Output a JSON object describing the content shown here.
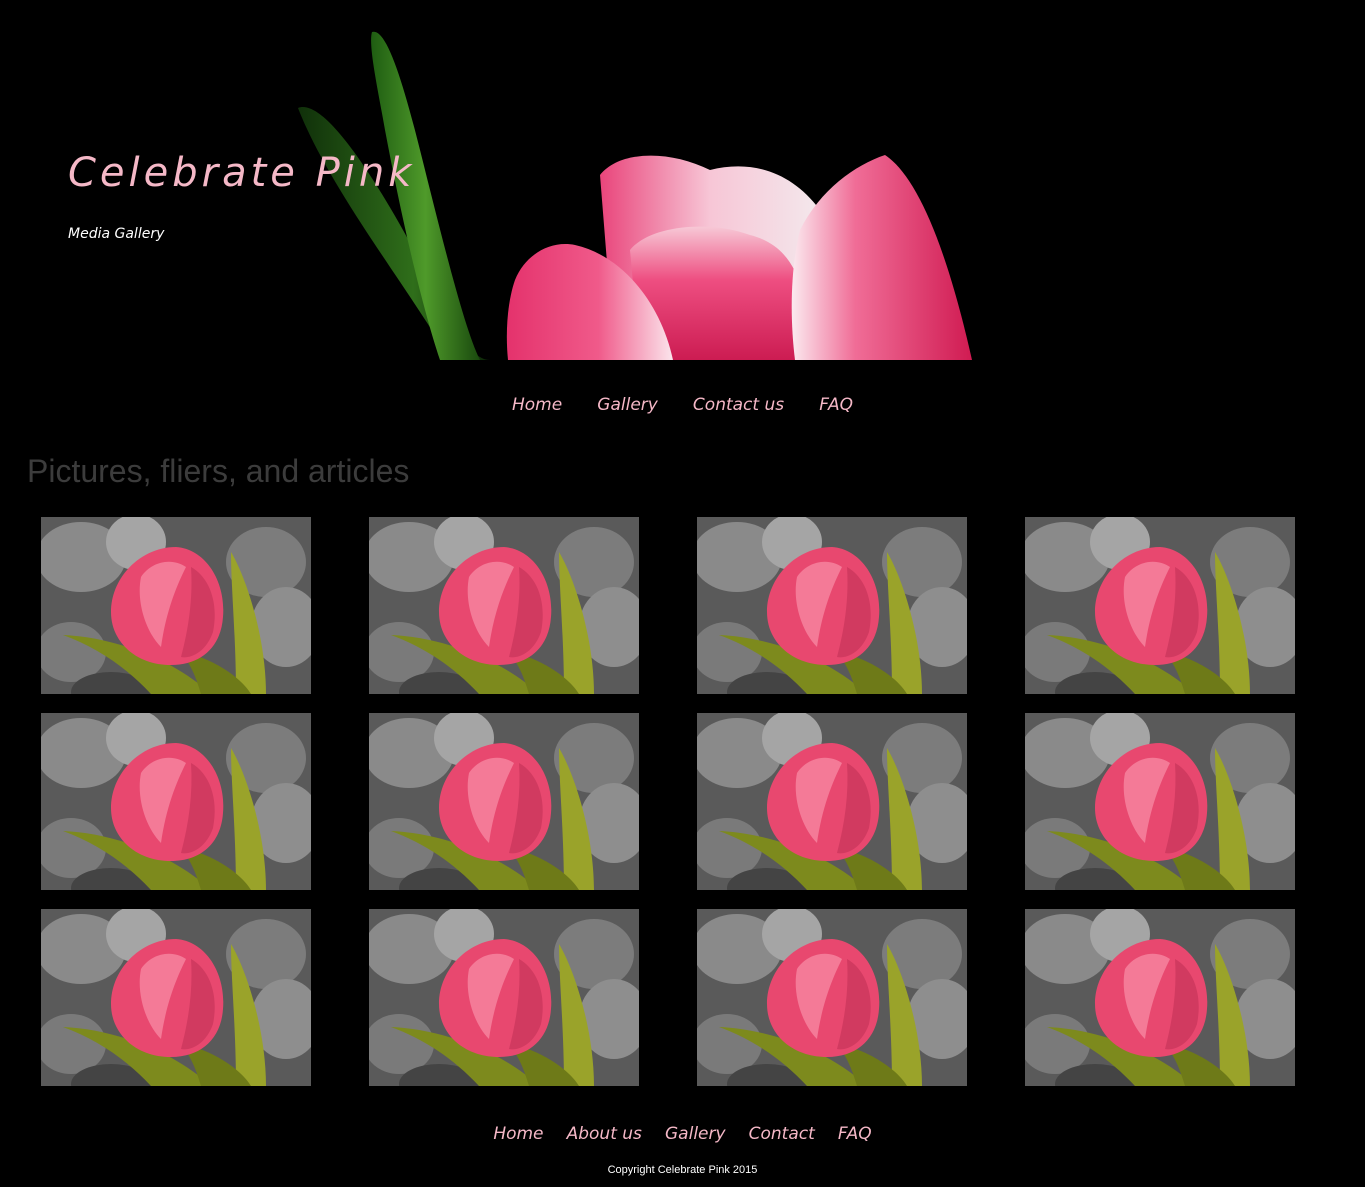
{
  "header": {
    "site_title": "Celebrate Pink",
    "site_subtitle": "Media Gallery"
  },
  "main_nav": {
    "items": [
      {
        "label": "Home"
      },
      {
        "label": "Gallery"
      },
      {
        "label": "Contact us"
      },
      {
        "label": "FAQ"
      }
    ]
  },
  "main": {
    "heading": "Pictures, fliers, and articles",
    "gallery": {
      "rows": 3,
      "columns": 4,
      "item_count": 12
    }
  },
  "footer": {
    "nav": [
      {
        "label": "Home"
      },
      {
        "label": "About us"
      },
      {
        "label": "Gallery"
      },
      {
        "label": "Contact"
      },
      {
        "label": "FAQ"
      }
    ],
    "copyright": "Copyright Celebrate Pink 2015"
  },
  "colors": {
    "background": "#000000",
    "accent_pink": "#f5b8c7",
    "heading_gray": "#3c3c3c",
    "text_white": "#ffffff"
  }
}
